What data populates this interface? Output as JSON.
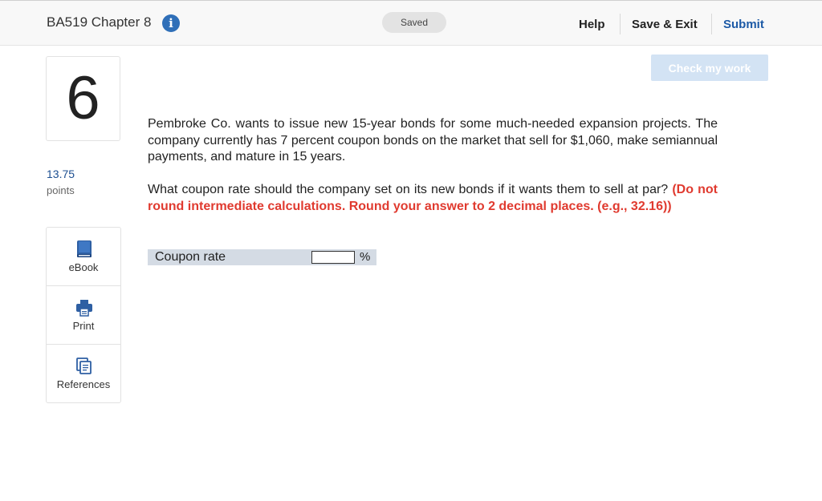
{
  "header": {
    "title": "BA519 Chapter 8",
    "status": "Saved",
    "help": "Help",
    "save_exit": "Save & Exit",
    "submit": "Submit"
  },
  "check_my_work": "Check my work",
  "question": {
    "number": "6",
    "points_value": "13.75",
    "points_label": "points",
    "paragraph1": "Pembroke Co. wants to issue new 15-year bonds for some much-needed expansion projects. The company currently has 7 percent coupon bonds on the market that sell for $1,060, make semiannual payments, and mature in 15 years.",
    "paragraph2_text": "What coupon rate should the company set on its new bonds if it wants them to sell at par? ",
    "paragraph2_instruction": "(Do not round intermediate calculations. Round your answer to 2 decimal places. (e.g., 32.16))"
  },
  "tools": [
    {
      "label": "eBook",
      "icon": "ebook-icon"
    },
    {
      "label": "Print",
      "icon": "print-icon"
    },
    {
      "label": "References",
      "icon": "references-icon"
    }
  ],
  "answer": {
    "label": "Coupon rate",
    "value": "",
    "unit": "%"
  },
  "colors": {
    "accent": "#1d5aa6",
    "instruction_red": "#e03a2f",
    "answer_row_bg": "#d4dbe4"
  }
}
